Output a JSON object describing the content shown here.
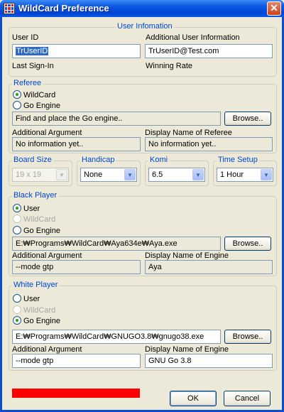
{
  "window": {
    "title": "WildCard Preference",
    "close_glyph": "✕",
    "app_icon": "wildcard-grid-icon"
  },
  "user_info": {
    "section_title": "User Infomation",
    "user_id_label": "User ID",
    "user_id_value": "TrUserID",
    "additional_label": "Additional User Information",
    "additional_value": "TrUserID@Test.com",
    "last_signin_label": "Last Sign-In",
    "winning_rate_label": "Winning Rate"
  },
  "referee": {
    "section_title": "Referee",
    "option_wildcard": "WildCard",
    "option_go_engine": "Go Engine",
    "selected": "WildCard",
    "engine_path": "Find and place the Go engine..",
    "browse_label": "Browse..",
    "arg_label": "Additional Argument",
    "arg_value": "No information yet..",
    "display_label": "Display Name of Referee",
    "display_value": "No information yet.."
  },
  "settings": {
    "board_size_label": "Board Size",
    "board_size_value": "19 x 19",
    "handicap_label": "Handicap",
    "handicap_value": "None",
    "komi_label": "Komi",
    "komi_value": "6.5",
    "time_label": "Time Setup",
    "time_value": "1 Hour"
  },
  "black_player": {
    "section_title": "Black Player",
    "option_user": "User",
    "option_wildcard": "WildCard",
    "option_go_engine": "Go Engine",
    "selected": "User",
    "engine_path": "E:₩Programs₩WildCard₩Aya634e₩Aya.exe",
    "browse_label": "Browse..",
    "arg_label": "Additional Argument",
    "arg_value": "--mode gtp",
    "display_label": "Display Name of Engine",
    "display_value": "Aya"
  },
  "white_player": {
    "section_title": "White Player",
    "option_user": "User",
    "option_wildcard": "WildCard",
    "option_go_engine": "Go Engine",
    "selected": "Go Engine",
    "engine_path": "E:₩Programs₩WildCard₩GNUGO3.8₩gnugo38.exe",
    "browse_label": "Browse..",
    "arg_label": "Additional Argument",
    "arg_value": "--mode gtp",
    "display_label": "Display Name of Engine",
    "display_value": "GNU Go 3.8"
  },
  "footer": {
    "ok_label": "OK",
    "cancel_label": "Cancel",
    "status_bar_color": "#ff0000"
  },
  "colors": {
    "title_bar": "#0a55e0",
    "section_title": "#0046d5",
    "dialog_bg": "#ece9d8"
  }
}
